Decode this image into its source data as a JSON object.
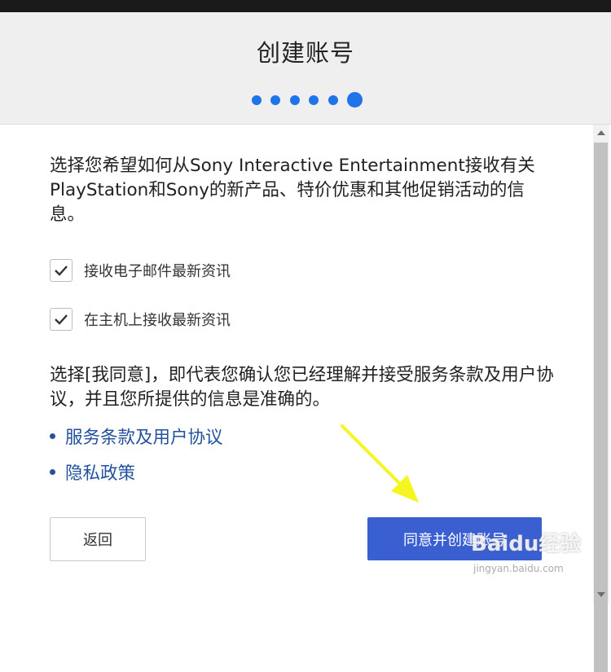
{
  "dialog": {
    "title": "创建账号"
  },
  "steps": {
    "total": 6,
    "current": 6
  },
  "content": {
    "description": "选择您希望如何从Sony Interactive Entertainment接收有关PlayStation和Sony的新产品、特价优惠和其他促销活动的信息。",
    "checkboxes": [
      {
        "label": "接收电子邮件最新资讯",
        "checked": true
      },
      {
        "label": "在主机上接收最新资讯",
        "checked": true
      }
    ],
    "agreement_text": "选择[我同意]，即代表您确认您已经理解并接受服务条款及用户协议，并且您所提供的信息是准确的。",
    "links": [
      {
        "label": "服务条款及用户协议"
      },
      {
        "label": "隐私政策"
      }
    ]
  },
  "buttons": {
    "back_label": "返回",
    "agree_label": "同意并创建账号"
  },
  "watermark": {
    "brand": "Baidu经验",
    "site": "jingyan.baidu.com"
  },
  "colors": {
    "accent": "#1e74e8",
    "primary_button": "#3a5fd1",
    "link": "#24519e",
    "annotation_arrow": "#f5f520"
  }
}
